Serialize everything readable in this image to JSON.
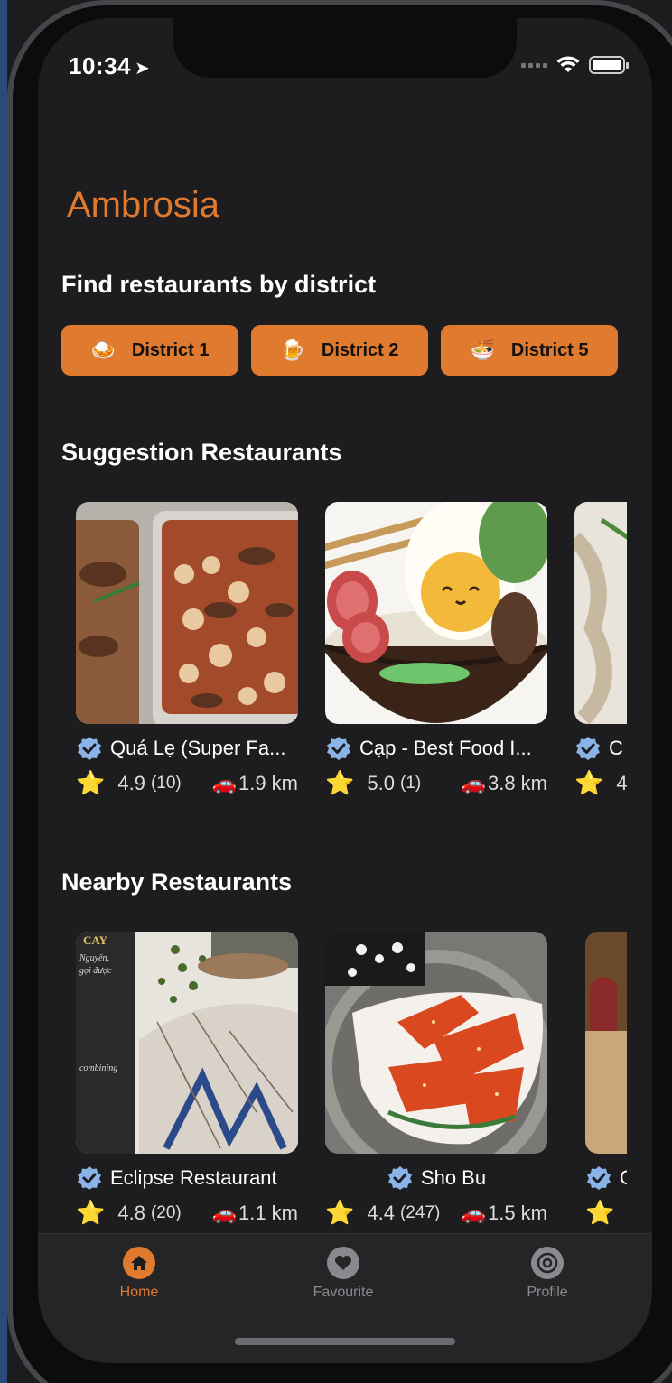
{
  "status": {
    "time": "10:34",
    "location_icon": "location-arrow-icon"
  },
  "app": {
    "title": "Ambrosia",
    "accent": "#e07a2f"
  },
  "districts_section": {
    "title": "Find restaurants by district",
    "buttons": [
      {
        "emoji": "🍛",
        "label": "District 1"
      },
      {
        "emoji": "🍺",
        "label": "District 2"
      },
      {
        "emoji": "🍜",
        "label": "District 5"
      }
    ]
  },
  "suggestion_section": {
    "title": "Suggestion Restaurants",
    "cards": [
      {
        "name": "Quá Lẹ (Super Fa...",
        "rating": "4.9",
        "reviews": "(10)",
        "distance": "1.9 km"
      },
      {
        "name": "Cạp - Best Food I...",
        "rating": "5.0",
        "reviews": "(1)",
        "distance": "3.8 km"
      },
      {
        "name": "C",
        "rating": "4",
        "reviews": "",
        "distance": ""
      }
    ]
  },
  "nearby_section": {
    "title": "Nearby Restaurants",
    "cards": [
      {
        "name": "Eclipse Restaurant",
        "rating": "4.8",
        "reviews": "(20)",
        "distance": "1.1 km",
        "photo_text_1": "CAY",
        "photo_text_2": "Nguyên,",
        "photo_text_3": "gọi được",
        "photo_text_4": "combining"
      },
      {
        "name": "Sho Bu",
        "rating": "4.4",
        "reviews": "(247)",
        "distance": "1.5 km"
      },
      {
        "name": "C",
        "rating": "",
        "reviews": "",
        "distance": ""
      }
    ]
  },
  "tabbar": {
    "tabs": [
      {
        "label": "Home",
        "icon": "home-icon",
        "active": true
      },
      {
        "label": "Favourite",
        "icon": "heart-icon",
        "active": false
      },
      {
        "label": "Profile",
        "icon": "settings-icon",
        "active": false
      }
    ]
  },
  "symbols": {
    "star": "⭐",
    "car": "🚗"
  }
}
